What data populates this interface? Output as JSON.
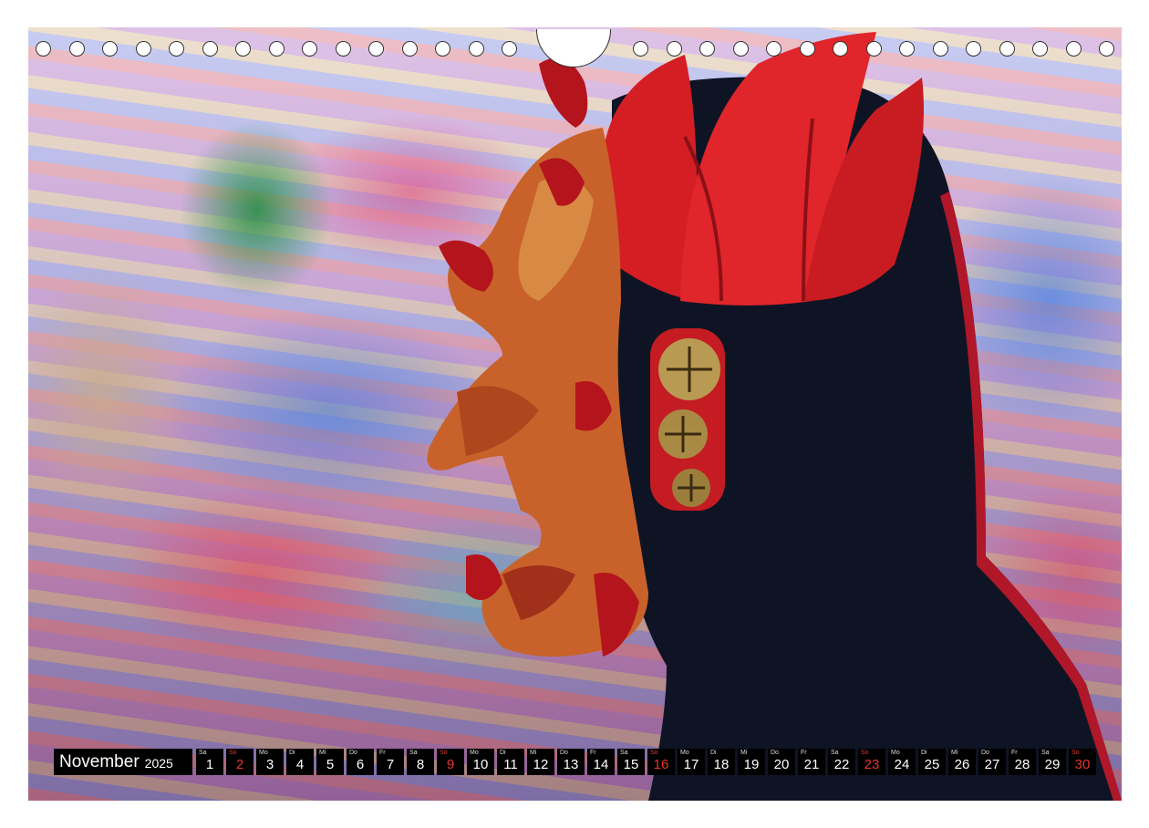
{
  "calendar": {
    "month": "November",
    "year": "2025",
    "days": [
      {
        "dw": "Sa",
        "n": "1",
        "weekend": false
      },
      {
        "dw": "So",
        "n": "2",
        "weekend": true
      },
      {
        "dw": "Mo",
        "n": "3",
        "weekend": false
      },
      {
        "dw": "Di",
        "n": "4",
        "weekend": false
      },
      {
        "dw": "Mi",
        "n": "5",
        "weekend": false
      },
      {
        "dw": "Do",
        "n": "6",
        "weekend": false
      },
      {
        "dw": "Fr",
        "n": "7",
        "weekend": false
      },
      {
        "dw": "Sa",
        "n": "8",
        "weekend": false
      },
      {
        "dw": "So",
        "n": "9",
        "weekend": true
      },
      {
        "dw": "Mo",
        "n": "10",
        "weekend": false
      },
      {
        "dw": "Di",
        "n": "11",
        "weekend": false
      },
      {
        "dw": "Mi",
        "n": "12",
        "weekend": false
      },
      {
        "dw": "Do",
        "n": "13",
        "weekend": false
      },
      {
        "dw": "Fr",
        "n": "14",
        "weekend": false
      },
      {
        "dw": "Sa",
        "n": "15",
        "weekend": false
      },
      {
        "dw": "So",
        "n": "16",
        "weekend": true
      },
      {
        "dw": "Mo",
        "n": "17",
        "weekend": false
      },
      {
        "dw": "Di",
        "n": "18",
        "weekend": false
      },
      {
        "dw": "Mi",
        "n": "19",
        "weekend": false
      },
      {
        "dw": "Do",
        "n": "20",
        "weekend": false
      },
      {
        "dw": "Fr",
        "n": "21",
        "weekend": false
      },
      {
        "dw": "Sa",
        "n": "22",
        "weekend": false
      },
      {
        "dw": "So",
        "n": "23",
        "weekend": true
      },
      {
        "dw": "Mo",
        "n": "24",
        "weekend": false
      },
      {
        "dw": "Di",
        "n": "25",
        "weekend": false
      },
      {
        "dw": "Mi",
        "n": "26",
        "weekend": false
      },
      {
        "dw": "Do",
        "n": "27",
        "weekend": false
      },
      {
        "dw": "Fr",
        "n": "28",
        "weekend": false
      },
      {
        "dw": "Sa",
        "n": "29",
        "weekend": false
      },
      {
        "dw": "So",
        "n": "30",
        "weekend": true
      }
    ]
  },
  "colors": {
    "weekend": "#e8342f",
    "bar": "#000000"
  },
  "binding": {
    "hole_count_left": 15,
    "hole_count_right": 15
  }
}
